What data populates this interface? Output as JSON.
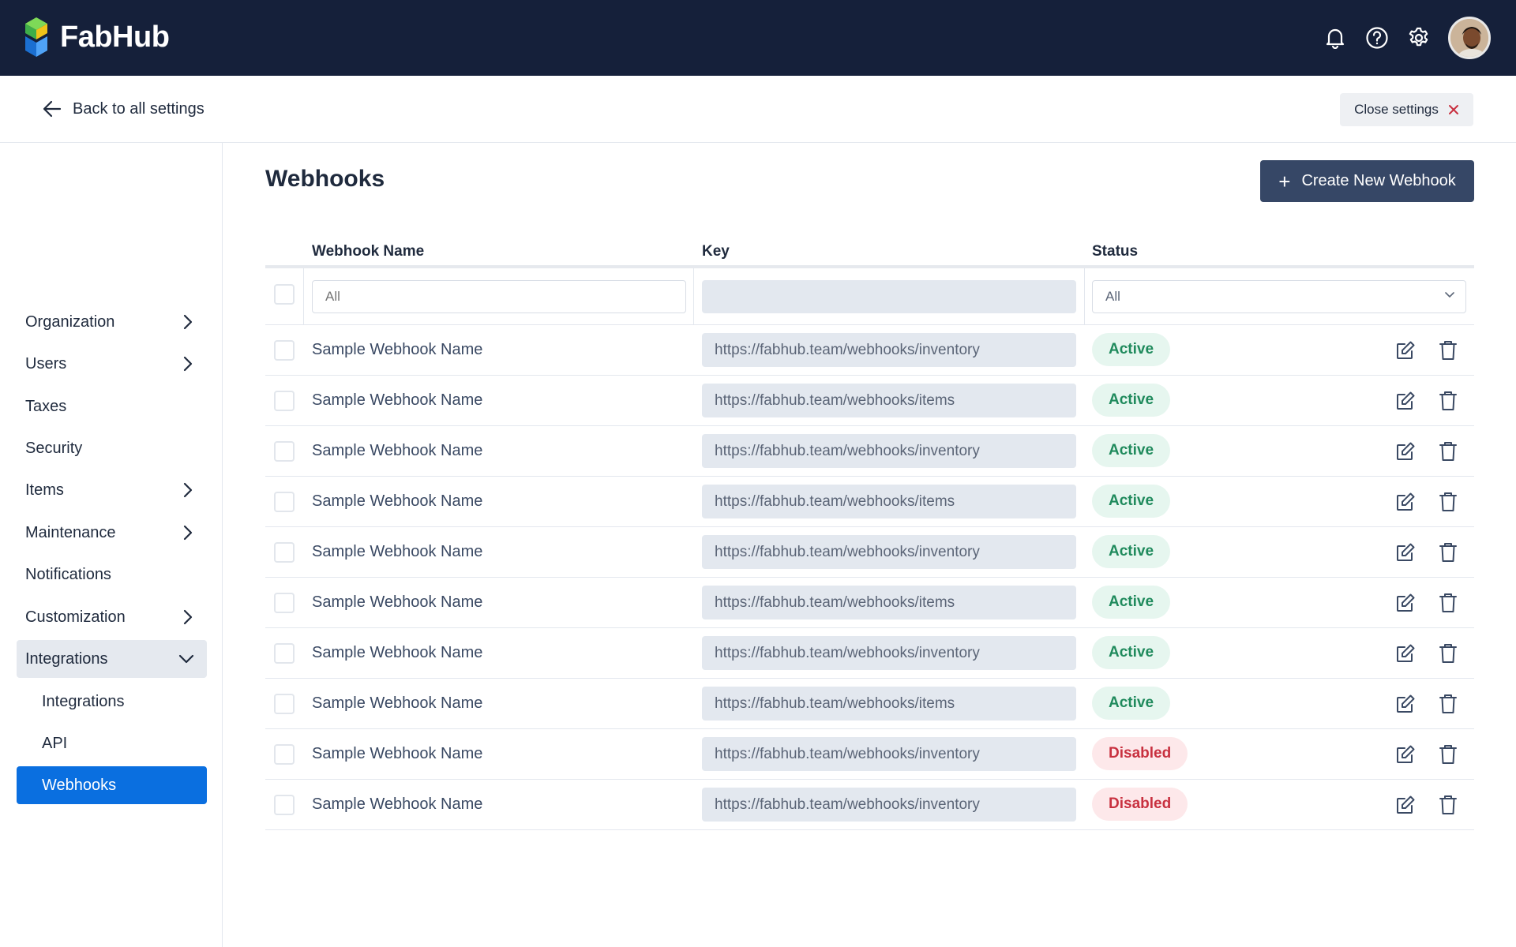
{
  "app": {
    "name": "FabHub"
  },
  "topbar": {
    "icons": [
      "bell-icon",
      "help-icon",
      "gear-icon"
    ]
  },
  "subheader": {
    "back_label": "Back to all settings",
    "close_label": "Close settings"
  },
  "sidebar": {
    "items": [
      {
        "label": "Organization",
        "chevron": "right"
      },
      {
        "label": "Users",
        "chevron": "right"
      },
      {
        "label": "Taxes",
        "chevron": ""
      },
      {
        "label": "Security",
        "chevron": ""
      },
      {
        "label": "Items",
        "chevron": "right"
      },
      {
        "label": "Maintenance",
        "chevron": "right"
      },
      {
        "label": "Notifications",
        "chevron": ""
      },
      {
        "label": "Customization",
        "chevron": "right"
      },
      {
        "label": "Integrations",
        "chevron": "down",
        "expanded": true
      },
      {
        "label": "Integrations",
        "sub": true
      },
      {
        "label": "API",
        "sub": true
      },
      {
        "label": "Webhooks",
        "sub": true,
        "active": true
      }
    ]
  },
  "main": {
    "title": "Webhooks",
    "create_label": "Create New Webhook"
  },
  "table": {
    "columns": [
      "Webhook Name",
      "Key",
      "Status"
    ],
    "filters": {
      "name_placeholder": "All",
      "key_value": "",
      "status_value": "All"
    },
    "rows": [
      {
        "name": "Sample Webhook Name",
        "key": "https://fabhub.team/webhooks/inventory",
        "status": "Active"
      },
      {
        "name": "Sample Webhook Name",
        "key": "https://fabhub.team/webhooks/items",
        "status": "Active"
      },
      {
        "name": "Sample Webhook Name",
        "key": "https://fabhub.team/webhooks/inventory",
        "status": "Active"
      },
      {
        "name": "Sample Webhook Name",
        "key": "https://fabhub.team/webhooks/items",
        "status": "Active"
      },
      {
        "name": "Sample Webhook Name",
        "key": "https://fabhub.team/webhooks/inventory",
        "status": "Active"
      },
      {
        "name": "Sample Webhook Name",
        "key": "https://fabhub.team/webhooks/items",
        "status": "Active"
      },
      {
        "name": "Sample Webhook Name",
        "key": "https://fabhub.team/webhooks/inventory",
        "status": "Active"
      },
      {
        "name": "Sample Webhook Name",
        "key": "https://fabhub.team/webhooks/items",
        "status": "Active"
      },
      {
        "name": "Sample Webhook Name",
        "key": "https://fabhub.team/webhooks/inventory",
        "status": "Disabled"
      },
      {
        "name": "Sample Webhook Name",
        "key": "https://fabhub.team/webhooks/inventory",
        "status": "Disabled"
      }
    ],
    "row_actions": [
      "edit-icon",
      "trash-icon"
    ]
  },
  "colors": {
    "topbar_bg": "#15203a",
    "active_nav": "#0a6fe0",
    "primary_button": "#364766",
    "status_active": "#1f8a5c",
    "status_disabled": "#c8303f"
  }
}
